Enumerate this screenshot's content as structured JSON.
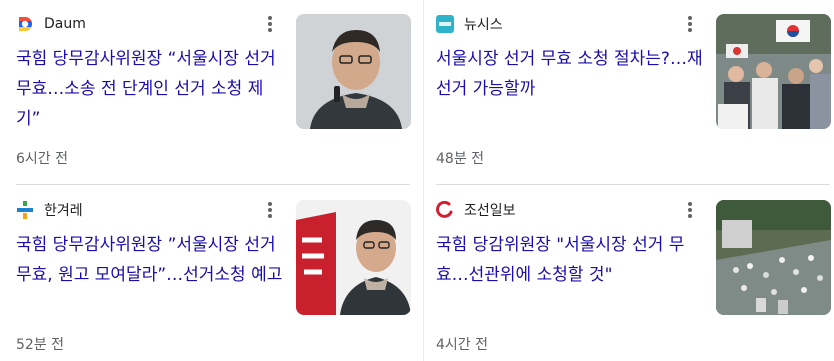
{
  "cards": [
    {
      "source": "Daum",
      "logo": "daum-logo",
      "headline": "국힘 당무감사위원장 “서울시장 선거 무효…소송 전 단계인 선거 소청 제기”",
      "time": "6시간 전",
      "thumb": "portrait of man in glasses, dark suit",
      "menu_icon": "more-vert-icon"
    },
    {
      "source": "뉴시스",
      "logo": "newsis-logo",
      "headline": "서울시장 선거 무효 소청 절차는?…재선거 가능할까",
      "time": "48분 전",
      "thumb": "crowd rally with Korean flags",
      "menu_icon": "more-vert-icon"
    },
    {
      "source": "한겨레",
      "logo": "hani-logo",
      "headline": "국힘 당무감사위원장 ”서울시장 선거 무효, 원고 모여달라”…선거소청 예고",
      "time": "52분 전",
      "thumb": "man speaking in front of red banner",
      "menu_icon": "more-vert-icon"
    },
    {
      "source": "조선일보",
      "logo": "chosun-logo",
      "headline": "국힘 당감위원장 \"서울시장 선거 무효…선관위에 소청할 것\"",
      "time": "4시간 전",
      "thumb": "aerial view of crowd in plaza",
      "menu_icon": "more-vert-icon"
    }
  ],
  "colors": {
    "headline": "#1a0dab",
    "meta": "#5f6368",
    "source": "#202124",
    "divider": "#dadce0"
  }
}
